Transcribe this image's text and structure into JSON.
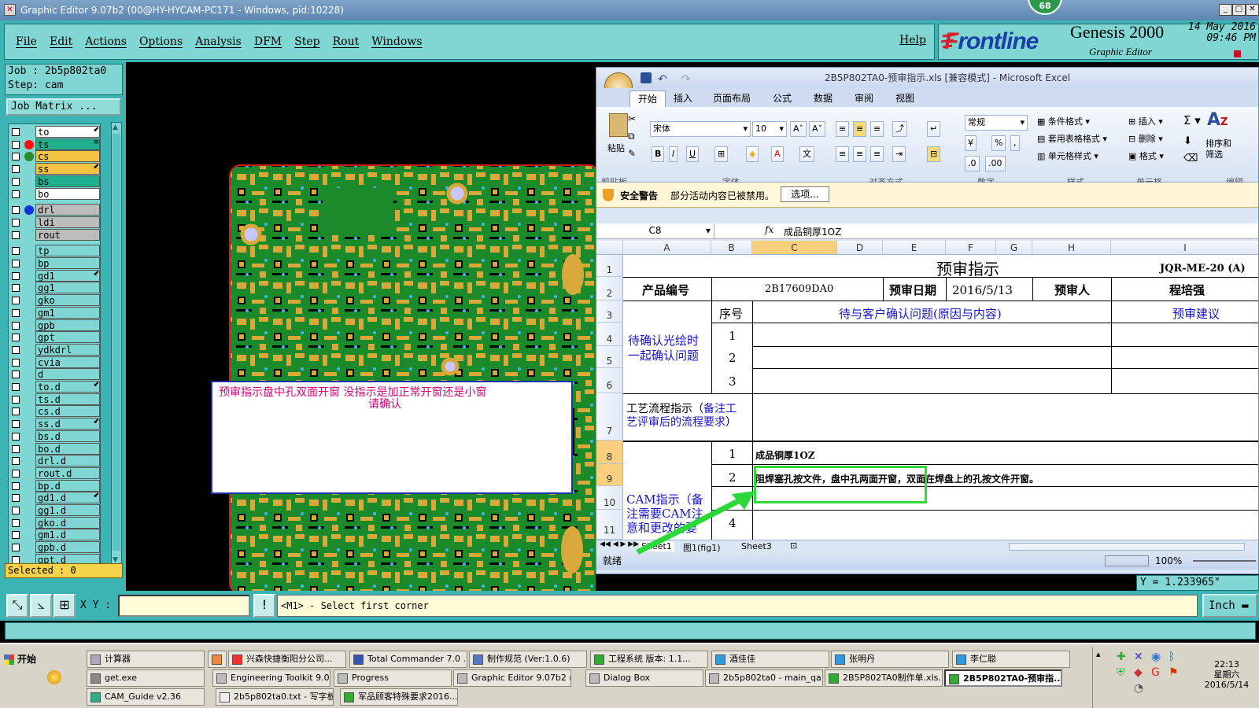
{
  "window": {
    "title": "Graphic Editor 9.07b2 (00@HY-HYCAM-PC171 - Windows, pid:10228)",
    "badge": "68"
  },
  "menu": [
    "File",
    "Edit",
    "Actions",
    "Options",
    "Analysis",
    "DFM",
    "Step",
    "Rout",
    "Windows"
  ],
  "help": "Help",
  "brand": {
    "logo_f": "F",
    "logo_rest": "rontline",
    "product": "Genesis 2000",
    "subtitle": "Graphic Editor",
    "date": "14 May 2016",
    "time": "09:46 PM"
  },
  "job": {
    "job_label": "Job : 2b5p802ta0",
    "step_label": "Step: cam"
  },
  "job_matrix": "Job Matrix ...",
  "layers": [
    {
      "name": "to",
      "color": "#ffffff",
      "dot": "",
      "mark": "⬋"
    },
    {
      "name": "ts",
      "color": "#1fae8e",
      "dot": "#ff1010",
      "mark": "≡"
    },
    {
      "name": "cs",
      "color": "#f4c242",
      "dot": "#2a8a2a",
      "mark": ""
    },
    {
      "name": "ss",
      "color": "#f4c242",
      "dot": "",
      "mark": "⬋"
    },
    {
      "name": "bs",
      "color": "#1fae8e",
      "dot": "",
      "mark": ""
    },
    {
      "name": "bo",
      "color": "#ffffff",
      "dot": "",
      "mark": ""
    },
    {
      "name": "drl",
      "color": "#bcbcbc",
      "dot": "#1030e0",
      "mark": ""
    },
    {
      "name": "ldi",
      "color": "#bcbcbc",
      "dot": "",
      "mark": ""
    },
    {
      "name": "rout",
      "color": "#bcbcbc",
      "dot": "",
      "mark": ""
    },
    {
      "name": "tp",
      "color": "#7fd6d2",
      "dot": "",
      "mark": ""
    },
    {
      "name": "bp",
      "color": "#7fd6d2",
      "dot": "",
      "mark": ""
    },
    {
      "name": "gd1",
      "color": "#7fd6d2",
      "dot": "",
      "mark": "⬋"
    },
    {
      "name": "gg1",
      "color": "#7fd6d2",
      "dot": "",
      "mark": ""
    },
    {
      "name": "gko",
      "color": "#7fd6d2",
      "dot": "",
      "mark": ""
    },
    {
      "name": "gm1",
      "color": "#7fd6d2",
      "dot": "",
      "mark": ""
    },
    {
      "name": "gpb",
      "color": "#7fd6d2",
      "dot": "",
      "mark": ""
    },
    {
      "name": "gpt",
      "color": "#7fd6d2",
      "dot": "",
      "mark": ""
    },
    {
      "name": "ydkdrl",
      "color": "#7fd6d2",
      "dot": "",
      "mark": ""
    },
    {
      "name": "cvia",
      "color": "#7fd6d2",
      "dot": "",
      "mark": ""
    },
    {
      "name": "d",
      "color": "#7fd6d2",
      "dot": "",
      "mark": ""
    },
    {
      "name": "to.d",
      "color": "#7fd6d2",
      "dot": "",
      "mark": "⬋"
    },
    {
      "name": "ts.d",
      "color": "#7fd6d2",
      "dot": "",
      "mark": ""
    },
    {
      "name": "cs.d",
      "color": "#7fd6d2",
      "dot": "",
      "mark": ""
    },
    {
      "name": "ss.d",
      "color": "#7fd6d2",
      "dot": "",
      "mark": "⬋"
    },
    {
      "name": "bs.d",
      "color": "#7fd6d2",
      "dot": "",
      "mark": ""
    },
    {
      "name": "bo.d",
      "color": "#7fd6d2",
      "dot": "",
      "mark": ""
    },
    {
      "name": "drl.d",
      "color": "#7fd6d2",
      "dot": "",
      "mark": ""
    },
    {
      "name": "rout.d",
      "color": "#7fd6d2",
      "dot": "",
      "mark": ""
    },
    {
      "name": "bp.d",
      "color": "#7fd6d2",
      "dot": "",
      "mark": ""
    },
    {
      "name": "gd1.d",
      "color": "#7fd6d2",
      "dot": "",
      "mark": "⬋"
    },
    {
      "name": "gg1.d",
      "color": "#7fd6d2",
      "dot": "",
      "mark": ""
    },
    {
      "name": "gko.d",
      "color": "#7fd6d2",
      "dot": "",
      "mark": ""
    },
    {
      "name": "gm1.d",
      "color": "#7fd6d2",
      "dot": "",
      "mark": ""
    },
    {
      "name": "gpb.d",
      "color": "#7fd6d2",
      "dot": "",
      "mark": ""
    },
    {
      "name": "gpt.d",
      "color": "#7fd6d2",
      "dot": "",
      "mark": ""
    }
  ],
  "selected": "Selected : 0",
  "annotation": {
    "line1": "预审指示盘中孔双面开窗  没指示是加正常开窗还是小窗",
    "line2": "请确认"
  },
  "excel": {
    "title": "2B5P802TA0-预审指示.xls  [兼容模式] - Microsoft Excel",
    "tabs": [
      "开始",
      "插入",
      "页面布局",
      "公式",
      "数据",
      "审阅",
      "视图"
    ],
    "groups": {
      "clipboard": "剪贴板",
      "font": "字体",
      "align": "对齐方式",
      "number": "数字",
      "style": "样式",
      "cells": "单元格",
      "edit": "编辑"
    },
    "paste": "粘贴",
    "font_name": "宋体",
    "font_size": "10",
    "number_format": "常规",
    "styles": [
      "条件格式",
      "套用表格格式",
      "单元格样式"
    ],
    "cell_ops": [
      "插入",
      "删除",
      "格式"
    ],
    "sort_label": "排序和\n筛选",
    "security": {
      "title": "安全警告",
      "text": "部分活动内容已被禁用。",
      "button": "选项..."
    },
    "cell_ref": "C8",
    "formula": "成品铜厚1OZ",
    "columns": [
      "A",
      "B",
      "C",
      "D",
      "E",
      "F",
      "G",
      "H",
      "I"
    ],
    "rows": [
      "1",
      "2",
      "3",
      "4",
      "5",
      "6",
      "7",
      "8",
      "9",
      "10",
      "11"
    ],
    "cells": {
      "title": "预审指示",
      "doc_no": "JQR-ME-20 (A)",
      "product_no_label": "产品编号",
      "product_no": "2B17609DA0",
      "review_date_label": "预审日期",
      "review_date": "2016/5/13",
      "reviewer_label": "预审人",
      "reviewer": "程培强",
      "seq_label": "序号",
      "pending_label": "待与客户确认问题(原因与内容)",
      "suggest_label": "预审建议",
      "confirm_label": "待确认光绘时一起确认问题",
      "n1": "1",
      "n2": "2",
      "n3": "3",
      "process_label_black": "工艺流程指示（",
      "process_label_blue": "备注工",
      "process_label2_blue": "艺评审后的流程要求",
      "process_label2_black": "）",
      "cam_label": "CAM指示（备注需要CAM注意和更改的要",
      "c1": "1",
      "c2": "2",
      "c4": "4",
      "cam_row1": "成品铜厚1OZ",
      "cam_row2": "阻焊塞孔按文件，盘中孔两面开窗，双面在焊盘上的孔按文件开窗。"
    },
    "sheets": [
      "Sheet1",
      "图1(fig1)",
      "Sheet3"
    ],
    "status_ready": "就绪",
    "zoom": "100%"
  },
  "ycoord": "Y = 1.233965\"",
  "xy_label": "X Y :",
  "xy_value": "",
  "command_msg": "<M1> - Select first corner",
  "units": "Inch",
  "taskbar": {
    "start": "开始",
    "row1": [
      "计算器",
      "",
      "兴森快捷衡阳分公司...",
      "Total Commander 7.0 ...",
      "制作规范 (Ver:1.0.6)",
      "工程系统  版本: 1.1...",
      "酒佳佳",
      "张明丹",
      "李仁聪"
    ],
    "row2": [
      "get.exe",
      "Engineering Toolkit 9.07...",
      "Progress",
      "Graphic Editor 9.07b2 (...",
      "Dialog Box",
      "2b5p802ta0 - main_qa",
      "2B5P802TA0制作单.xls...",
      "2B5P802TA0-预审指..."
    ],
    "row3": [
      "CAM_Guide v2.36",
      "2b5p802ta0.txt - 写字板",
      "军品顾客特殊要求2016..."
    ],
    "clock_time": "22:13",
    "clock_day": "星期六",
    "clock_date": "2016/5/14"
  }
}
